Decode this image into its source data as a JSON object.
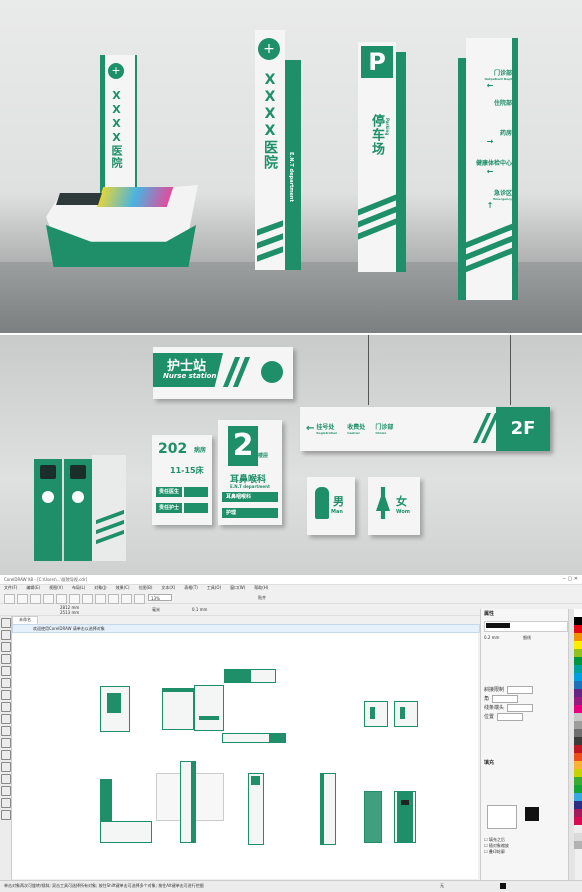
{
  "render1": {
    "kiosk_vertical_text": "XXXX医院",
    "tower_text": "XXXX医院",
    "tower_sub": "E.N.T department",
    "parking_letter": "P",
    "parking_text": "停车场",
    "parking_sub": "Parking",
    "directory_items": [
      {
        "label": "门诊部",
        "sub": "Outpatient Dept",
        "arrow": "←"
      },
      {
        "label": "住院部",
        "sub": "",
        "arrow": ""
      },
      {
        "label": "药房",
        "sub": "",
        "arrow": "→"
      },
      {
        "label": "健康体检中心",
        "sub": "",
        "arrow": "←"
      },
      {
        "label": "急诊区",
        "sub": "Emergency",
        "arrow": "↑"
      }
    ]
  },
  "render2": {
    "nurse_station_cn": "护士站",
    "nurse_station_en": "Nurse station",
    "room_number": "202",
    "room_suffix": "病房",
    "bed_range": "11-15床",
    "doctor_label": "责任医生",
    "nurse_label": "责任护士",
    "dept_number": "2",
    "dept_floor_label": "楼层",
    "dept_name": "耳鼻喉科",
    "dept_en": "E.N.T department",
    "dept_row1": "耳鼻咽喉科",
    "dept_row2": "护理",
    "hanging_items": [
      {
        "arrow": "←",
        "cn": "挂号处",
        "en": "Registration"
      },
      {
        "cn": "收费处",
        "en": "Cashier"
      },
      {
        "cn": "门诊部",
        "en": "Clinics"
      }
    ],
    "hanging_floor": "2F",
    "men_cn": "男",
    "men_en": "Man",
    "women_cn": "女",
    "women_en": "Wom"
  },
  "app": {
    "title_bar": "CorelDRAW X8 - [C:\\Users\\...\\医院导视.cdr]",
    "menu": [
      "文件(F)",
      "编辑(E)",
      "视图(V)",
      "布局(L)",
      "对象(J)",
      "效果(C)",
      "位图(B)",
      "文本(X)",
      "表格(T)",
      "工具(O)",
      "窗口(W)",
      "帮助(H)"
    ],
    "zoom_value": "13%",
    "snap_label": "贴齐",
    "unit_label": "毫米",
    "width_value": "2812 mm",
    "height_value": "2513 mm",
    "nudge_value": "0.1 mm",
    "tab_label": "未命名",
    "hint_text": "欢迎使用CorelDRAW 请单击以选择对象",
    "docker_title": "属性",
    "docker_tab": "轮廓",
    "docker_outline_width": "0.2 mm",
    "docker_outline_style": "细线",
    "docker_section_fill": "填充",
    "status_left": "单击对象两次可旋转/倾斜; 双击工具可选择所有对象; 按住Shift键单击可选择多个对象; 按住Alt键单击可进行挖掘",
    "status_right": "无",
    "accent": "#1f8f6a"
  }
}
